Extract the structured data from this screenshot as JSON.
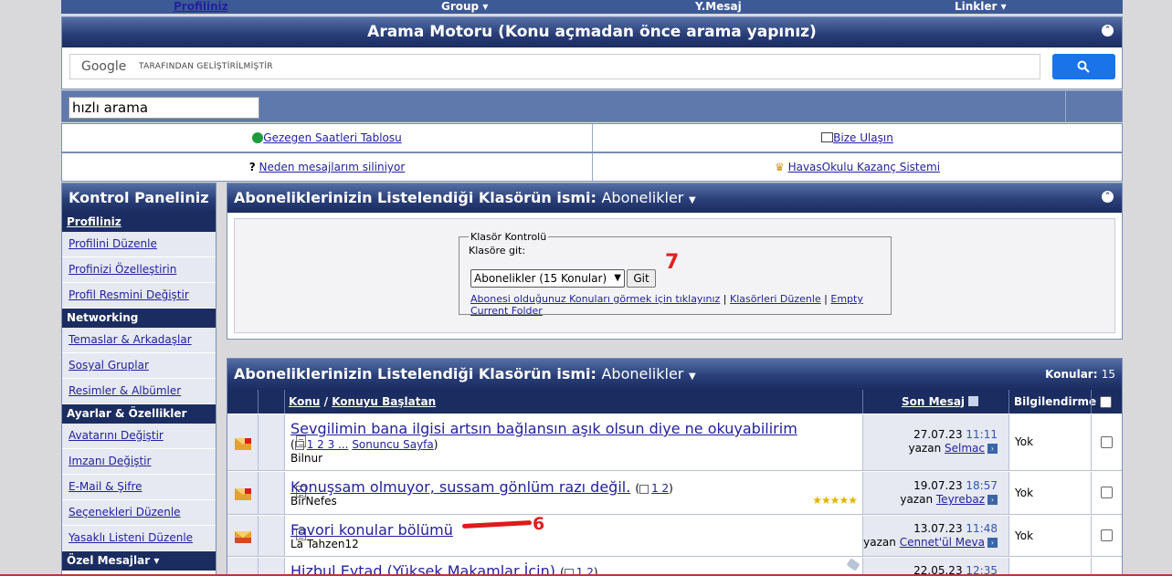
{
  "top_nav": {
    "items": [
      "Profiliniz",
      "Group ▾",
      "Y.Mesaj",
      "Linkler ▾"
    ]
  },
  "search_engine": {
    "title": "Arama Motoru (Konu açmadan önce arama yapınız)",
    "google_label": "Google",
    "google_sub": "TARAFINDAN GELİŞTİRİLMİŞTİR"
  },
  "quick_search": {
    "value": "hızlı arama"
  },
  "link_rows": {
    "gezegen": "Gezegen Saatleri Tablosu",
    "bize_ulasin": "Bize Ulaşın",
    "neden": "Neden mesajlarım siliniyor",
    "havasokulu": "HavasOkulu Kazanç Sistemi"
  },
  "sidebar": {
    "title": "Kontrol Paneliniz",
    "sections": [
      {
        "label": "Profiliniz",
        "items": [
          "Profilini Düzenle",
          "Profinizi Özelleştirin",
          "Profil Resmini Değiştir"
        ]
      },
      {
        "label": "Networking",
        "items": [
          "Temaslar & Arkadaşlar",
          "Sosyal Gruplar",
          "Resimler & Albümler"
        ]
      },
      {
        "label": "Ayarlar & Özellikler",
        "items": [
          "Avatarını Değiştir",
          "Imzanı Değiştir",
          "E-Mail & Şifre",
          "Seçenekleri Düzenle",
          "Yasaklı Listeni Düzenle"
        ]
      },
      {
        "label": "Özel Mesajlar ▾",
        "items": []
      }
    ]
  },
  "folder_panel": {
    "title": "Aboneliklerinizin Listelendiği Klasörün ismi",
    "folder": "Abonelikler",
    "fieldset_legend": "Klasör Kontrolü",
    "goto_label": "Klasöre git:",
    "select_value": "Abonelikler (15 Konular)",
    "go_button": "Git",
    "link_subscribed": "Abonesi olduğunuz Konuları görmek için tıklayınız",
    "link_edit": "Klasörleri Düzenle",
    "link_empty": "Empty Current Folder",
    "annotation": "7"
  },
  "threads_panel": {
    "title": "Aboneliklerinizin Listelendiği Klasörün ismi",
    "folder": "Abonelikler",
    "count_label": "Konular:",
    "count": "15",
    "headers": {
      "konu": "Konu",
      "slash": "/",
      "baslatan": "Konuyu Başlatan",
      "son_mesaj": "Son Mesaj",
      "bilgi": "Bilgilendirme"
    },
    "rows": [
      {
        "title": "Sevgilimin bana ilgisi artsın bağlansın aşık olsun diye ne okuyabilirim",
        "pages": "1 2 3 ...",
        "last_page": "Sonuncu Sayfa",
        "author": "Bilnur",
        "date": "27.07.23",
        "time": "11:11",
        "by": "yazan",
        "last_user": "Selmac",
        "notify": "Yok"
      },
      {
        "title": "Konuşsam olmuyor, sussam gönlüm razı değil.",
        "pages": "1 2",
        "author": "BirNefes",
        "date": "19.07.23",
        "time": "18:57",
        "by": "yazan",
        "last_user": "Teyrebaz",
        "notify": "Yok",
        "rating": "★★★★★"
      },
      {
        "title": "Favori konular bölümü",
        "author": "La Tahzen12",
        "date": "13.07.23",
        "time": "11:48",
        "by": "yazan",
        "last_user": "Cennet'ül Meva",
        "notify": "Yok"
      },
      {
        "title": "Hizbul Eytad (Yüksek Makamlar İçin)",
        "pages": "1 2",
        "date": "22.05.23",
        "time": "12:35"
      }
    ],
    "annotation": "6"
  }
}
